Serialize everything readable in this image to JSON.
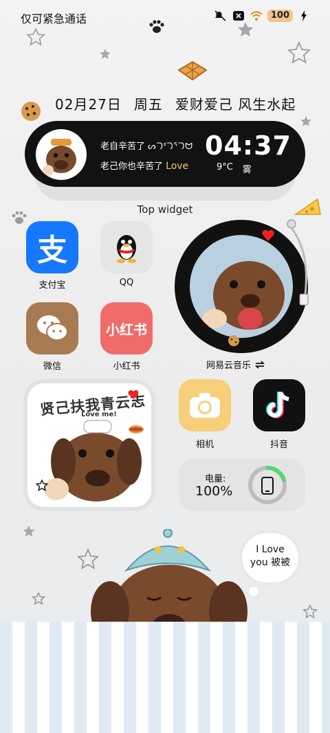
{
  "status_bar": {
    "carrier_text": "仅可紧急通话",
    "battery": "100"
  },
  "date_line": {
    "date": "02月27日",
    "weekday": "周五",
    "motto": "爱财爱己 风生水起"
  },
  "top_widget": {
    "line1": "老自辛苦了",
    "line1_scribble": "ᔕᘄᓫᘄᕐᘄᗢ",
    "line2": "老己你也辛苦了",
    "line2_love": "Love",
    "time": "04:37",
    "temperature": "9°C",
    "weather": "雾",
    "label": "Top widget"
  },
  "apps": [
    {
      "name": "支付宝",
      "icon": "alipay-icon",
      "glyph": "支"
    },
    {
      "name": "QQ",
      "icon": "qq-penguin-icon"
    },
    {
      "name": "微信",
      "icon": "wechat-icon"
    },
    {
      "name": "小红书",
      "icon": "xiaohongshu-icon",
      "glyph": "小红书"
    },
    {
      "name": "相机",
      "icon": "camera-icon"
    },
    {
      "name": "抖音",
      "icon": "tiktok-icon"
    }
  ],
  "music_widget": {
    "label": "网易云音乐",
    "switch_icon": "swap-arrows-icon"
  },
  "photo_widget": {
    "title": "贤己扶我青云志",
    "subtitle": "Love me!"
  },
  "battery_widget": {
    "label": "电量:",
    "value": "100%",
    "level": 1.0
  },
  "sticker_bubble": {
    "line1": "I Love",
    "line2": "you 被被"
  },
  "colors": {
    "alipay": "#1677ff",
    "wechat": "#a87a52",
    "xiaohongshu": "#f16b6b",
    "camera": "#f7cf7a",
    "tiktok": "#111111",
    "battery_ring": "#55d86a"
  }
}
